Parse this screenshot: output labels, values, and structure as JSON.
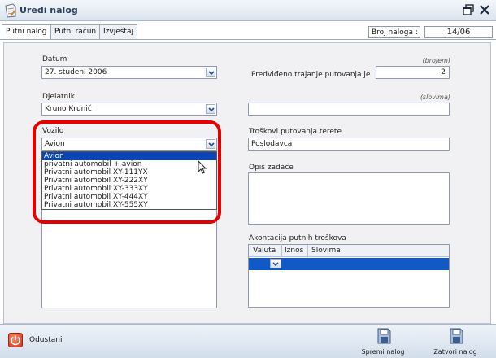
{
  "window": {
    "title": "Uredi nalog"
  },
  "tabs": [
    {
      "label": "Putni nalog",
      "active": true
    },
    {
      "label": "Putni račun",
      "active": false
    },
    {
      "label": "Izvještaj",
      "active": false
    }
  ],
  "broj_naloga": {
    "label": "Broj naloga :",
    "value": "14/06"
  },
  "datum": {
    "label": "Datum",
    "value": "27. studeni 2006"
  },
  "trajanje": {
    "hint": "(brojem)",
    "label": "Predviđeno trajanje putovanja je",
    "value": "2"
  },
  "djelatnik": {
    "label": "Djelatnik",
    "value": "Kruno Krunić"
  },
  "slovima": {
    "hint": "(slovima)",
    "value": ""
  },
  "vozilo": {
    "label": "Vozilo",
    "value": "Avion",
    "options": [
      "Avion",
      "privatni automobil + avion",
      "Privatni automobil XY-111YX",
      "Privatni automobil XY-222XY",
      "Privatni automobil XY-333XY",
      "Privatni automobil XY-444XY",
      "Privatni automobil XY-555XY"
    ],
    "selected_index": 0
  },
  "troskovi": {
    "label": "Troškovi putovanja terete",
    "value": "Poslodavca"
  },
  "opis": {
    "label": "Opis zadaće",
    "value": ""
  },
  "akontacija": {
    "label": "Akontacija putnih troškova",
    "columns": [
      "Valuta",
      "Iznos",
      "Slovima"
    ]
  },
  "footer": {
    "cancel_label": "Odustani",
    "save_label": "Spremi nalog",
    "close_label": "Zatvori nalog"
  },
  "colors": {
    "highlight": "#e60000",
    "selection": "#0a46b8",
    "grid_row": "#1059c7"
  },
  "icons": [
    "document-icon",
    "maximize-icon",
    "close-icon",
    "chevron-down-icon",
    "power-icon",
    "save-icon"
  ]
}
